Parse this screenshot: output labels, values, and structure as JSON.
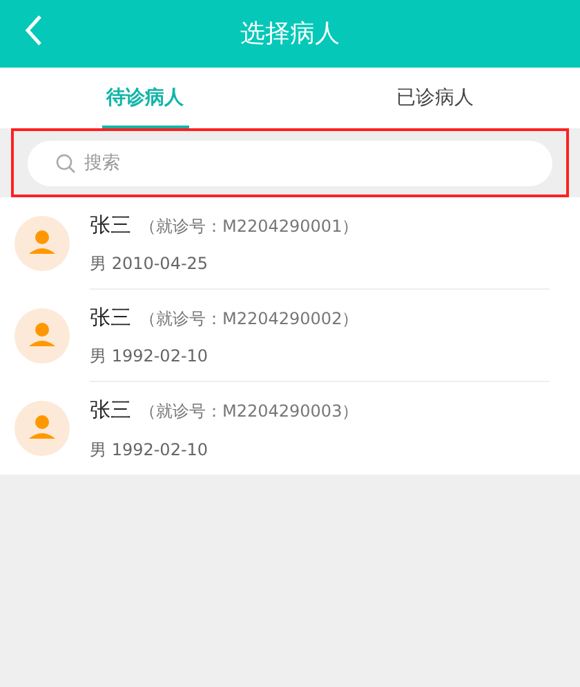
{
  "header": {
    "title": "选择病人"
  },
  "tabs": [
    {
      "label": "待诊病人",
      "selected": true
    },
    {
      "label": "已诊病人",
      "selected": false
    }
  ],
  "search": {
    "placeholder": "搜索",
    "highlighted": true
  },
  "patients": [
    {
      "name": "张三",
      "visit_no": "（就诊号：M2204290001）",
      "info": "男 2010-04-25"
    },
    {
      "name": "张三",
      "visit_no": "（就诊号：M2204290002）",
      "info": "男 1992-02-10"
    },
    {
      "name": "张三",
      "visit_no": "（就诊号：M2204290003）",
      "info": "男 1992-02-10"
    }
  ]
}
